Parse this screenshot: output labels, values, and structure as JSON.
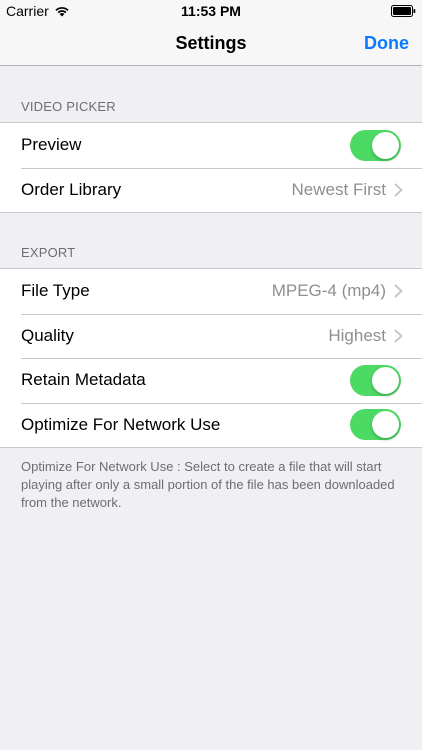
{
  "status_bar": {
    "carrier": "Carrier",
    "time": "11:53 PM"
  },
  "nav": {
    "title": "Settings",
    "done_label": "Done",
    "accent_color": "#0a7aff"
  },
  "sections": {
    "video_picker": {
      "header": "VIDEO PICKER",
      "preview_label": "Preview",
      "preview_on": true,
      "order_label": "Order Library",
      "order_value": "Newest First"
    },
    "export": {
      "header": "EXPORT",
      "file_type_label": "File Type",
      "file_type_value": "MPEG-4 (mp4)",
      "quality_label": "Quality",
      "quality_value": "Highest",
      "retain_label": "Retain Metadata",
      "retain_on": true,
      "optimize_label": "Optimize For Network Use",
      "optimize_on": true,
      "footer": "Optimize For Network Use : Select to create a file that will start playing after only a small portion of the file has been downloaded from the network."
    }
  },
  "colors": {
    "toggle_on": "#4cd964",
    "background": "#efeff4"
  },
  "icons": {
    "wifi": "wifi-icon",
    "battery": "battery-icon",
    "chevron": "chevron-right-icon"
  }
}
